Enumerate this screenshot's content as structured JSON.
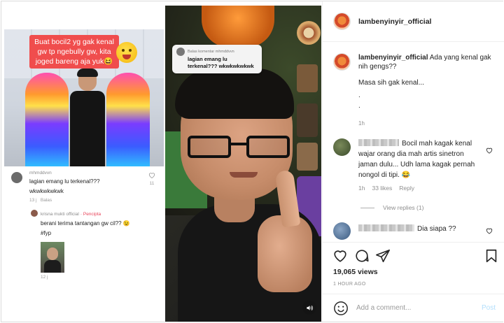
{
  "tiktok_left": {
    "video_caption": "Buat bocil2 yg gak kenal gw tp ngebully gw, kita joged bareng aja yuk😆",
    "comment1": {
      "username": "mhmddvvn",
      "text_line1": "lagian emang lu terkenal???",
      "text_line2": "wkwkwkwkwk",
      "time": "13 j",
      "reply_label": "Balas",
      "likes": "11"
    },
    "comment2": {
      "username": "krisna mukti official",
      "creator_badge": "· Pencipta",
      "text_line1": "berani terima tantangan gw cil?? 😉",
      "text_line2": "#fyp",
      "time": "12 j"
    }
  },
  "tiktok_right": {
    "reply_to_label": "Balas komentar mhmddvvn",
    "reply_line1": "lagian emang lu",
    "reply_line2": "terkenal??? wkwkwkwkwk",
    "sound_icon": "speaker-icon"
  },
  "post": {
    "username": "lambenyinyir_official",
    "caption_user": "lambenyinyir_official",
    "caption_line1": "Ada yang kenal gak nih gengs??",
    "caption_line2": "Masa sih gak kenal...",
    "caption_line3": ".",
    "caption_line4": ".",
    "caption_time": "1h",
    "comments": [
      {
        "text": "Bocil mah kagak kenal wajar orang dia mah artis sinetron jaman dulu... Udh lama kagak pernah nongol di tipi. 😂",
        "time": "1h",
        "likes": "33 likes",
        "reply": "Reply",
        "avatar_color": "#4a5a3a"
      },
      {
        "text": "Dia siapa ??",
        "avatar_color": "#5a7aa0"
      }
    ],
    "view_replies": "View replies (1)",
    "views": "19,065 views",
    "ago": "1 HOUR AGO",
    "add_comment_placeholder": "Add a comment...",
    "post_button": "Post"
  },
  "icons": {
    "like": "heart-icon",
    "comment": "comment-icon",
    "share": "send-icon",
    "save": "bookmark-icon",
    "emoji": "smiley-icon"
  },
  "colors": {
    "link_blue_disabled": "#b2dffc",
    "caption_red": "#f04d4d",
    "creator_pink": "#e8445a",
    "muted_gray": "#8e8e8e"
  }
}
